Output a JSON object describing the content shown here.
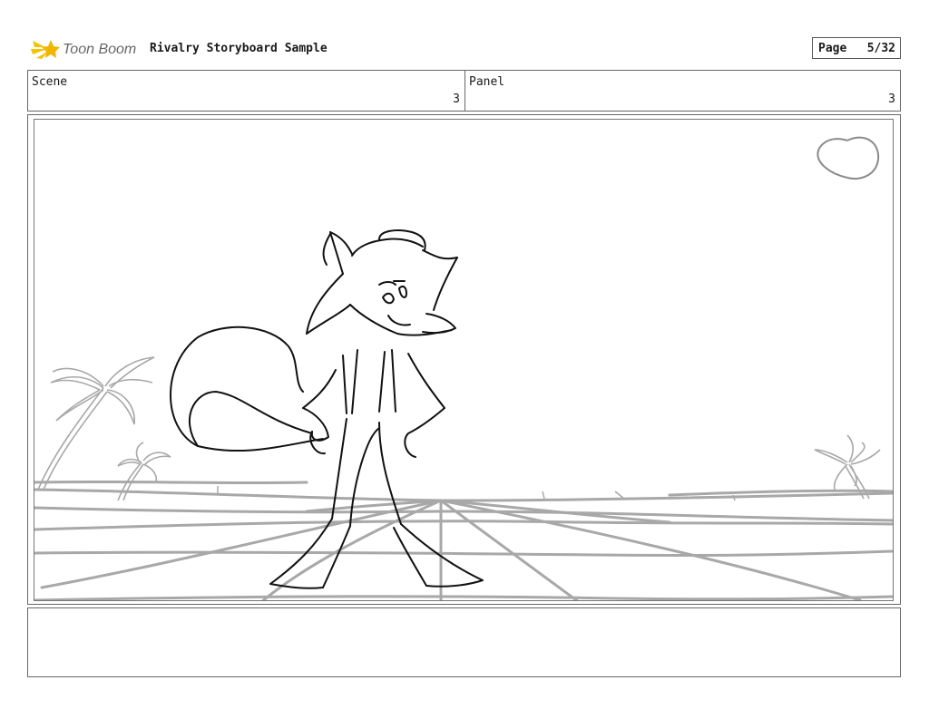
{
  "header": {
    "logo_text": "Toon Boom",
    "title": "Rivalry Storyboard Sample",
    "page_label": "Page",
    "page_value": "5/32"
  },
  "scene": {
    "label": "Scene",
    "value": "3"
  },
  "panel": {
    "label": "Panel",
    "value": "3"
  },
  "colors": {
    "logo_yellow": "#f2b600",
    "logo_gray": "#666666",
    "line": "#111111",
    "bg_line": "#a8a8a8"
  },
  "notes": {
    "text": ""
  }
}
